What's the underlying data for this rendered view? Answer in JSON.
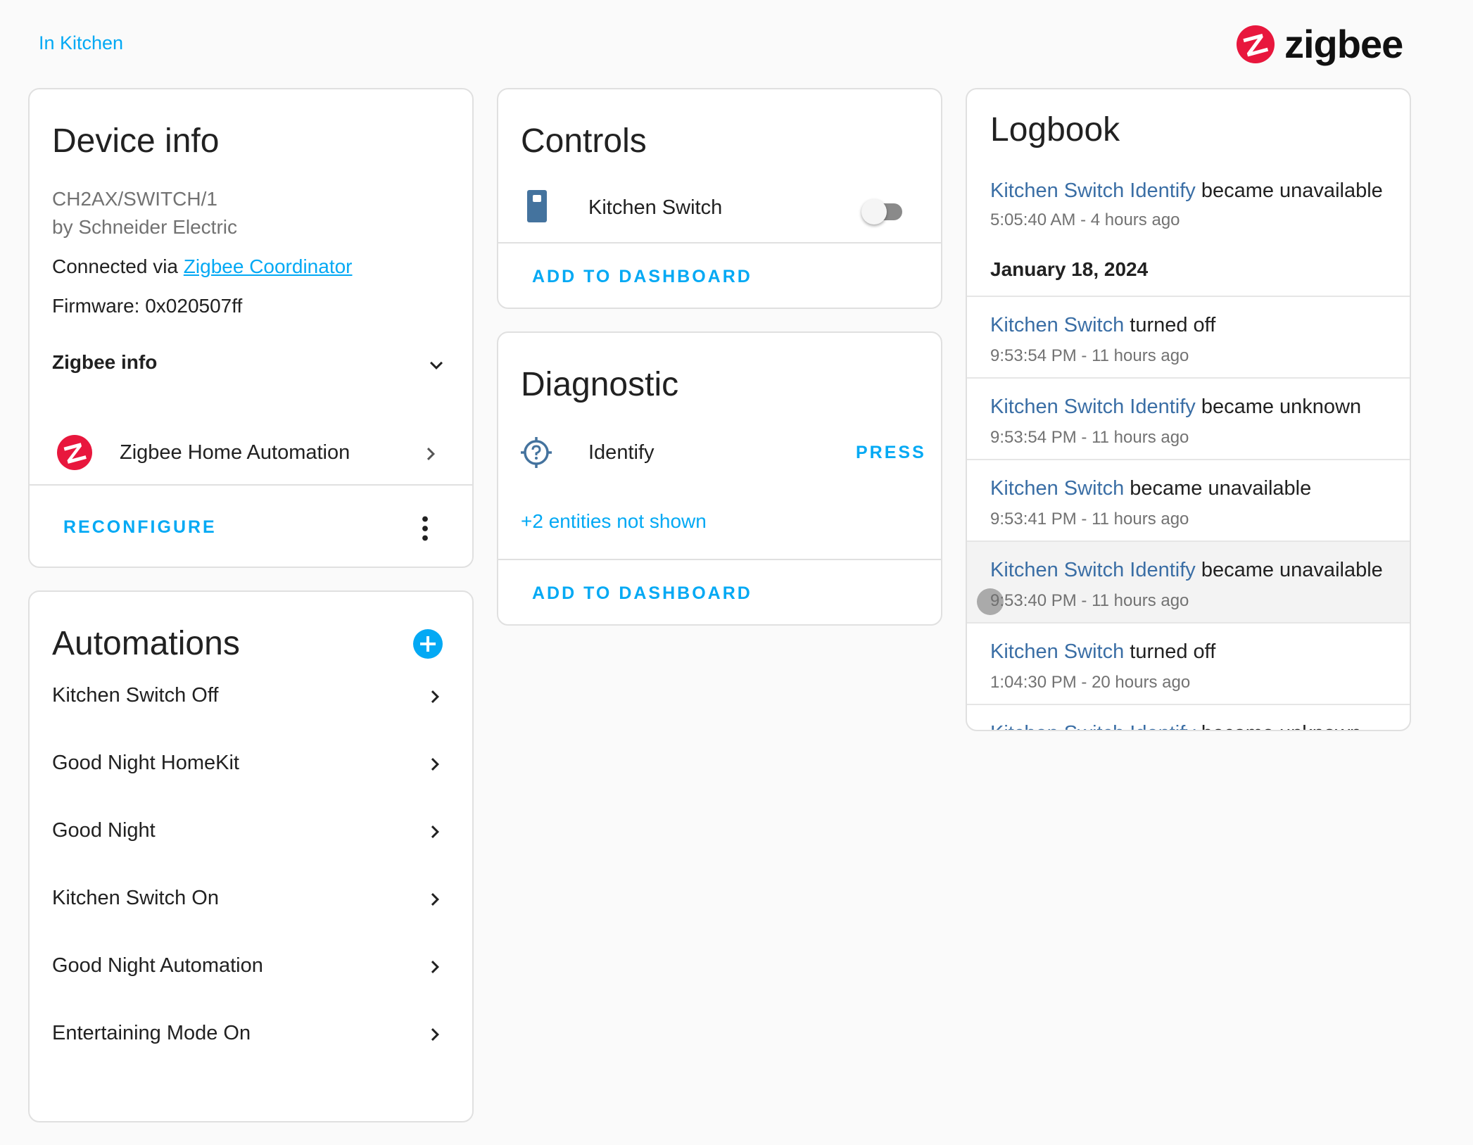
{
  "breadcrumb": {
    "area_link": "In Kitchen"
  },
  "brand": {
    "logo_text": "zigbee",
    "logo_color": "#e8173d"
  },
  "colors": {
    "accent": "#03a9f4",
    "link": "#3a6ea5"
  },
  "device_info": {
    "title": "Device info",
    "model": "CH2AX/SWITCH/1",
    "manufacturer": "by Schneider Electric",
    "connected_via_prefix": "Connected via ",
    "connected_via_link": "Zigbee Coordinator",
    "firmware": "Firmware: 0x020507ff",
    "zigbee_info_label": "Zigbee info",
    "integration_label": "Zigbee Home Automation",
    "reconfigure_label": "RECONFIGURE"
  },
  "automations": {
    "title": "Automations",
    "items": [
      {
        "label": "Kitchen Switch Off"
      },
      {
        "label": "Good Night HomeKit"
      },
      {
        "label": "Good Night"
      },
      {
        "label": "Kitchen Switch On"
      },
      {
        "label": "Good Night Automation"
      },
      {
        "label": "Entertaining Mode On"
      }
    ]
  },
  "controls": {
    "title": "Controls",
    "entity_label": "Kitchen Switch",
    "entity_icon": "light-switch-icon",
    "toggle_state": "off",
    "add_to_dashboard": "ADD TO DASHBOARD"
  },
  "diagnostic": {
    "title": "Diagnostic",
    "entity_label": "Identify",
    "entity_icon": "crosshairs-question-icon",
    "press_label": "PRESS",
    "hidden_entities": "+2 entities not shown",
    "add_to_dashboard": "ADD TO DASHBOARD"
  },
  "logbook": {
    "title": "Logbook",
    "top_entry": {
      "entity": "Kitchen Switch Identify",
      "action": " became unavailable",
      "time": "5:05:40 AM - 4 hours ago"
    },
    "date_header": "January 18, 2024",
    "entries": [
      {
        "entity": "Kitchen Switch",
        "action": " turned off",
        "time": "9:53:54 PM - 11 hours ago"
      },
      {
        "entity": "Kitchen Switch Identify",
        "action": " became unknown",
        "time": "9:53:54 PM - 11 hours ago"
      },
      {
        "entity": "Kitchen Switch",
        "action": " became unavailable",
        "time": "9:53:41 PM - 11 hours ago"
      },
      {
        "entity": "Kitchen Switch Identify",
        "action": " became unavailable",
        "time": "9:53:40 PM - 11 hours ago"
      },
      {
        "entity": "Kitchen Switch",
        "action": " turned off",
        "time": "1:04:30 PM - 20 hours ago"
      },
      {
        "entity": "Kitchen Switch Identify",
        "action": " became unknown",
        "time": ""
      }
    ]
  }
}
